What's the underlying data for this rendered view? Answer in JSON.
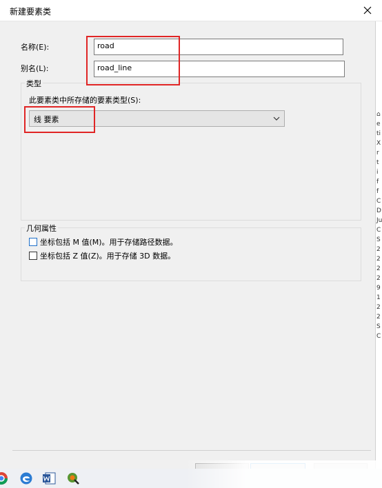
{
  "dialog": {
    "title": "新建要素类"
  },
  "form": {
    "name_label": "名称(E):",
    "name_value": "road",
    "alias_label": "别名(L):",
    "alias_value": "road_line"
  },
  "type_group": {
    "title": "类型",
    "prompt": "此要素类中所存储的要素类型(S):",
    "selected": "线 要素"
  },
  "geometry_group": {
    "title": "几何属性",
    "option_m": "坐标包括 M 值(M)。用于存储路径数据。",
    "option_z": "坐标包括 Z 值(Z)。用于存储 3D 数据。",
    "option_m_checked": false,
    "option_z_checked": false
  },
  "side_strip": [
    "⌂",
    "e",
    "ti",
    "X",
    "r",
    "t",
    "i",
    "f",
    "f",
    "C",
    "D",
    "Ju",
    "C",
    "S",
    "2",
    "2",
    "2",
    "2",
    "9",
    "1",
    "2",
    "2",
    "S",
    "C"
  ],
  "taskbar": {
    "icons": [
      "chrome-icon",
      "edge-icon",
      "word-icon",
      "qgis-icon"
    ]
  },
  "colors": {
    "highlight": "#e02424",
    "accent": "#0078d7"
  }
}
